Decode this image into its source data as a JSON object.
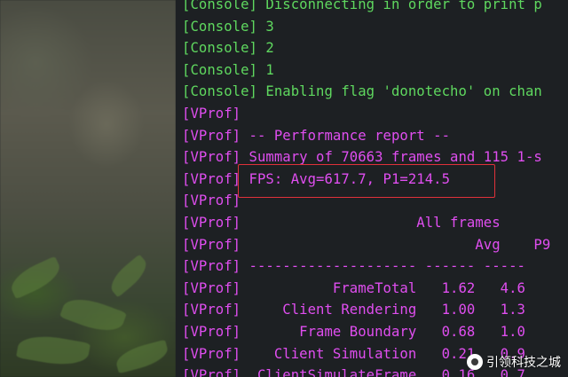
{
  "lines": [
    {
      "prefix": "[Console]",
      "text": " Disconnecting in order to print p",
      "color": "#5fd85f"
    },
    {
      "prefix": "[Console]",
      "text": " 3",
      "color": "#5fd85f"
    },
    {
      "prefix": "[Console]",
      "text": " 2",
      "color": "#5fd85f"
    },
    {
      "prefix": "[Console]",
      "text": " 1",
      "color": "#5fd85f"
    },
    {
      "prefix": "[Console]",
      "text": " Enabling flag 'donotecho' on chan",
      "color": "#5fd85f"
    },
    {
      "prefix": "[VProf]",
      "text": "",
      "color": "#e04ef0"
    },
    {
      "prefix": "[VProf]",
      "text": " -- Performance report --",
      "color": "#e04ef0"
    },
    {
      "prefix": "[VProf]",
      "text": " Summary of 70663 frames and 115 1-s",
      "color": "#e04ef0"
    },
    {
      "prefix": "[VProf]",
      "text": " FPS: Avg=617.7, P1=214.5",
      "color": "#e04ef0"
    },
    {
      "prefix": "[VProf]",
      "text": "",
      "color": "#e04ef0"
    },
    {
      "prefix": "[VProf]",
      "text": "                     All frames",
      "color": "#e04ef0"
    },
    {
      "prefix": "[VProf]",
      "text": "                            Avg    P9",
      "color": "#e04ef0"
    },
    {
      "prefix": "[VProf]",
      "text": " -------------------- ------ -----",
      "color": "#e04ef0"
    },
    {
      "prefix": "[VProf]",
      "text": "           FrameTotal   1.62   4.6",
      "color": "#e04ef0"
    },
    {
      "prefix": "[VProf]",
      "text": "     Client Rendering   1.00   1.3",
      "color": "#e04ef0"
    },
    {
      "prefix": "[VProf]",
      "text": "       Frame Boundary   0.68   1.0",
      "color": "#e04ef0"
    },
    {
      "prefix": "[VProf]",
      "text": "    Client Simulation   0.21   0.9",
      "color": "#e04ef0"
    },
    {
      "prefix": "[VProf]",
      "text": "  ClientSimulateFrame   0.16   0.7",
      "color": "#e04ef0"
    }
  ],
  "watermark": {
    "text": "引领科技之城"
  },
  "colors": {
    "console_green": "#5fd85f",
    "vprof_magenta": "#e04ef0",
    "highlight_red": "#e0313a",
    "background": "#1d2023"
  }
}
